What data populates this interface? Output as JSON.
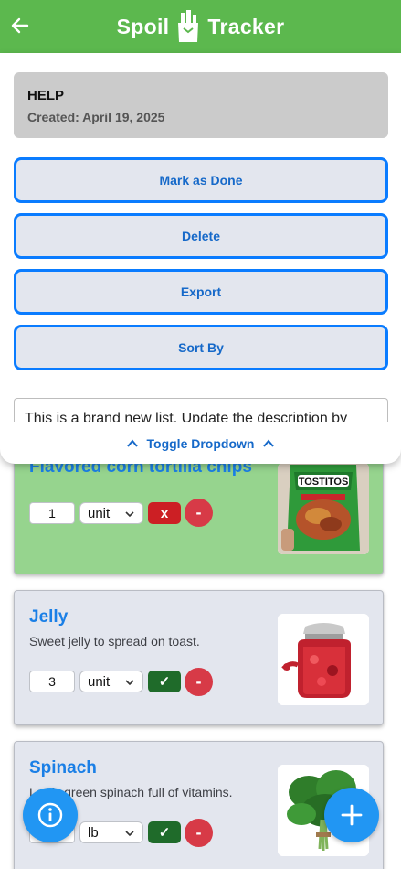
{
  "header": {
    "title_left": "Spoil",
    "title_right": "Tracker"
  },
  "list_info": {
    "title": "HELP",
    "created": "Created: April 19, 2025"
  },
  "actions": {
    "mark_done": "Mark as Done",
    "delete": "Delete",
    "export": "Export",
    "sort_by": "Sort By"
  },
  "description": "This is a brand new list. Update the description by",
  "toggle_label": "Toggle Dropdown",
  "items": [
    {
      "title": "Flavored corn tortilla chips",
      "description": "",
      "quantity": "1",
      "unit": "unit",
      "status_symbol": "x",
      "status": "done",
      "minus": "-",
      "image": "tostitos-bag"
    },
    {
      "title": "Jelly",
      "description": "Sweet jelly to spread on toast.",
      "quantity": "3",
      "unit": "unit",
      "status_symbol": "✓",
      "status": "not-done",
      "minus": "-",
      "image": "jelly-jar"
    },
    {
      "title": "Spinach",
      "description": "Leafy green spinach full of vitamins.",
      "quantity": "",
      "unit": "lb",
      "status_symbol": "✓",
      "status": "not-done",
      "minus": "-",
      "image": "spinach-bunch"
    }
  ],
  "colors": {
    "header": "#5cb84e",
    "done_card": "#96d48e",
    "todo_card": "#e3e6ee",
    "accent": "#0a7cff",
    "fab": "#2196f3",
    "remove": "#d73a47"
  }
}
